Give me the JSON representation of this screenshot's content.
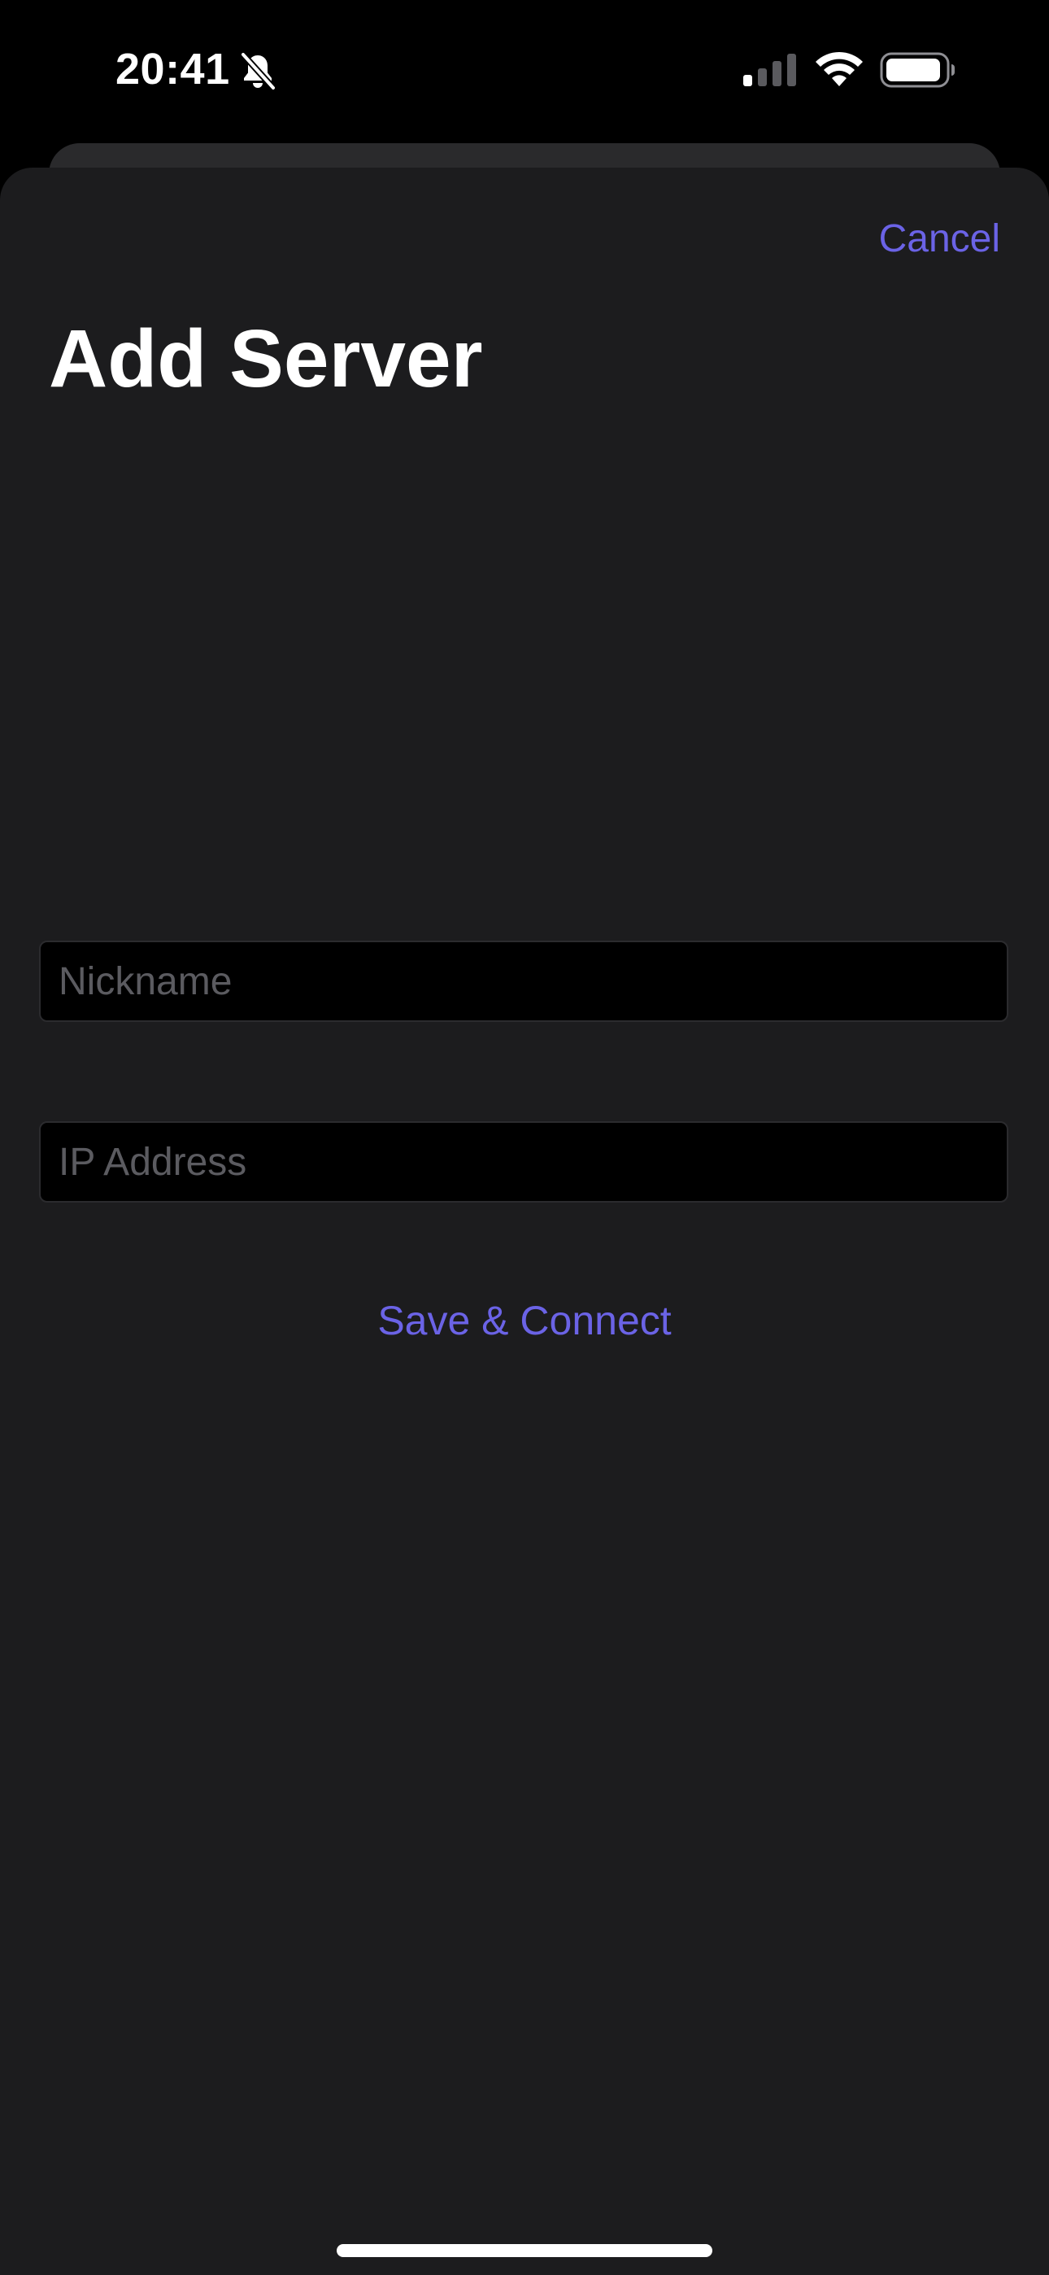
{
  "status_bar": {
    "time": "20:41",
    "icons": [
      "bell-slash-icon",
      "cellular-signal-icon",
      "wifi-icon",
      "battery-icon"
    ]
  },
  "sheet": {
    "cancel_label": "Cancel",
    "title": "Add Server",
    "nickname_field": {
      "value": "",
      "placeholder": "Nickname"
    },
    "ip_address_field": {
      "value": "",
      "placeholder": "IP Address"
    },
    "save_connect_label": "Save & Connect"
  },
  "colors": {
    "accent": "#6b63e6",
    "sheet_background": "#1c1c1e",
    "field_background": "#000000",
    "placeholder": "#5b5b60"
  }
}
